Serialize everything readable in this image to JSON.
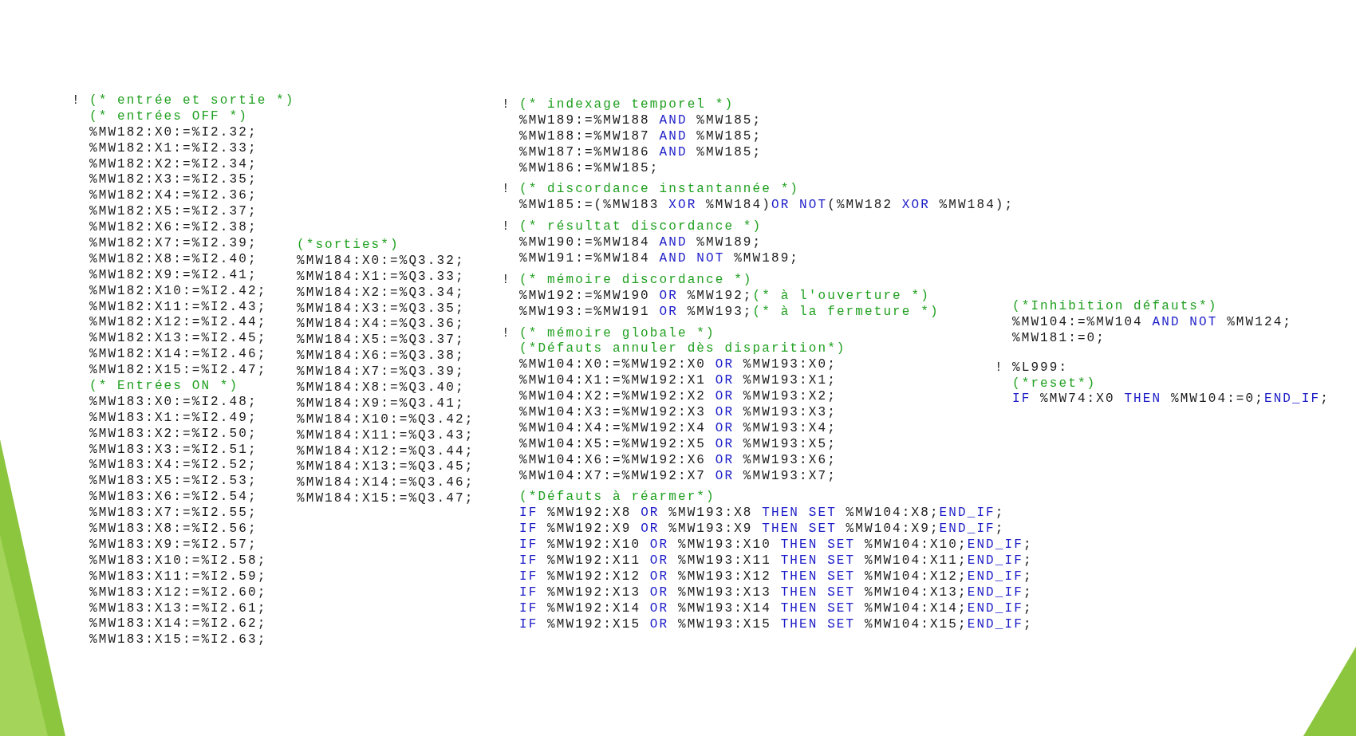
{
  "code_blocks": [
    {
      "sections": [
        {
          "lines": [
            {
              "marker": "!",
              "tokens": [
                {
                  "kind": "comment",
                  "text": "(* entrée et sortie *)"
                }
              ]
            },
            {
              "tokens": [
                {
                  "kind": "comment",
                  "text": "(* entrées OFF *)"
                }
              ]
            },
            {
              "tokens": [
                {
                  "kind": "code",
                  "text": "%MW182:X0:=%I2.32;"
                }
              ]
            },
            {
              "tokens": [
                {
                  "kind": "code",
                  "text": "%MW182:X1:=%I2.33;"
                }
              ]
            },
            {
              "tokens": [
                {
                  "kind": "code",
                  "text": "%MW182:X2:=%I2.34;"
                }
              ]
            },
            {
              "tokens": [
                {
                  "kind": "code",
                  "text": "%MW182:X3:=%I2.35;"
                }
              ]
            },
            {
              "tokens": [
                {
                  "kind": "code",
                  "text": "%MW182:X4:=%I2.36;"
                }
              ]
            },
            {
              "tokens": [
                {
                  "kind": "code",
                  "text": "%MW182:X5:=%I2.37;"
                }
              ]
            },
            {
              "tokens": [
                {
                  "kind": "code",
                  "text": "%MW182:X6:=%I2.38;"
                }
              ]
            },
            {
              "tokens": [
                {
                  "kind": "code",
                  "text": "%MW182:X7:=%I2.39;"
                }
              ]
            },
            {
              "tokens": [
                {
                  "kind": "code",
                  "text": "%MW182:X8:=%I2.40;"
                }
              ]
            },
            {
              "tokens": [
                {
                  "kind": "code",
                  "text": "%MW182:X9:=%I2.41;"
                }
              ]
            },
            {
              "tokens": [
                {
                  "kind": "code",
                  "text": "%MW182:X10:=%I2.42;"
                }
              ]
            },
            {
              "tokens": [
                {
                  "kind": "code",
                  "text": "%MW182:X11:=%I2.43;"
                }
              ]
            },
            {
              "tokens": [
                {
                  "kind": "code",
                  "text": "%MW182:X12:=%I2.44;"
                }
              ]
            },
            {
              "tokens": [
                {
                  "kind": "code",
                  "text": "%MW182:X13:=%I2.45;"
                }
              ]
            },
            {
              "tokens": [
                {
                  "kind": "code",
                  "text": "%MW182:X14:=%I2.46;"
                }
              ]
            },
            {
              "tokens": [
                {
                  "kind": "code",
                  "text": "%MW182:X15:=%I2.47;"
                }
              ]
            },
            {
              "tokens": [
                {
                  "kind": "comment",
                  "text": "(* Entrées ON *)"
                }
              ]
            },
            {
              "tokens": [
                {
                  "kind": "code",
                  "text": "%MW183:X0:=%I2.48;"
                }
              ]
            },
            {
              "tokens": [
                {
                  "kind": "code",
                  "text": "%MW183:X1:=%I2.49;"
                }
              ]
            },
            {
              "tokens": [
                {
                  "kind": "code",
                  "text": "%MW183:X2:=%I2.50;"
                }
              ]
            },
            {
              "tokens": [
                {
                  "kind": "code",
                  "text": "%MW183:X3:=%I2.51;"
                }
              ]
            },
            {
              "tokens": [
                {
                  "kind": "code",
                  "text": "%MW183:X4:=%I2.52;"
                }
              ]
            },
            {
              "tokens": [
                {
                  "kind": "code",
                  "text": "%MW183:X5:=%I2.53;"
                }
              ]
            },
            {
              "tokens": [
                {
                  "kind": "code",
                  "text": "%MW183:X6:=%I2.54;"
                }
              ]
            },
            {
              "tokens": [
                {
                  "kind": "code",
                  "text": "%MW183:X7:=%I2.55;"
                }
              ]
            },
            {
              "tokens": [
                {
                  "kind": "code",
                  "text": "%MW183:X8:=%I2.56;"
                }
              ]
            },
            {
              "tokens": [
                {
                  "kind": "code",
                  "text": "%MW183:X9:=%I2.57;"
                }
              ]
            },
            {
              "tokens": [
                {
                  "kind": "code",
                  "text": "%MW183:X10:=%I2.58;"
                }
              ]
            },
            {
              "tokens": [
                {
                  "kind": "code",
                  "text": "%MW183:X11:=%I2.59;"
                }
              ]
            },
            {
              "tokens": [
                {
                  "kind": "code",
                  "text": "%MW183:X12:=%I2.60;"
                }
              ]
            },
            {
              "tokens": [
                {
                  "kind": "code",
                  "text": "%MW183:X13:=%I2.61;"
                }
              ]
            },
            {
              "tokens": [
                {
                  "kind": "code",
                  "text": "%MW183:X14:=%I2.62;"
                }
              ]
            },
            {
              "tokens": [
                {
                  "kind": "code",
                  "text": "%MW183:X15:=%I2.63;"
                }
              ]
            }
          ]
        }
      ]
    },
    {
      "sections": [
        {
          "lines": [
            {
              "tokens": [
                {
                  "kind": "comment",
                  "text": "(*sorties*)"
                }
              ]
            },
            {
              "tokens": [
                {
                  "kind": "code",
                  "text": "%MW184:X0:=%Q3.32;"
                }
              ]
            },
            {
              "tokens": [
                {
                  "kind": "code",
                  "text": "%MW184:X1:=%Q3.33;"
                }
              ]
            },
            {
              "tokens": [
                {
                  "kind": "code",
                  "text": "%MW184:X2:=%Q3.34;"
                }
              ]
            },
            {
              "tokens": [
                {
                  "kind": "code",
                  "text": "%MW184:X3:=%Q3.35;"
                }
              ]
            },
            {
              "tokens": [
                {
                  "kind": "code",
                  "text": "%MW184:X4:=%Q3.36;"
                }
              ]
            },
            {
              "tokens": [
                {
                  "kind": "code",
                  "text": "%MW184:X5:=%Q3.37;"
                }
              ]
            },
            {
              "tokens": [
                {
                  "kind": "code",
                  "text": "%MW184:X6:=%Q3.38;"
                }
              ]
            },
            {
              "tokens": [
                {
                  "kind": "code",
                  "text": "%MW184:X7:=%Q3.39;"
                }
              ]
            },
            {
              "tokens": [
                {
                  "kind": "code",
                  "text": "%MW184:X8:=%Q3.40;"
                }
              ]
            },
            {
              "tokens": [
                {
                  "kind": "code",
                  "text": "%MW184:X9:=%Q3.41;"
                }
              ]
            },
            {
              "tokens": [
                {
                  "kind": "code",
                  "text": "%MW184:X10:=%Q3.42;"
                }
              ]
            },
            {
              "tokens": [
                {
                  "kind": "code",
                  "text": "%MW184:X11:=%Q3.43;"
                }
              ]
            },
            {
              "tokens": [
                {
                  "kind": "code",
                  "text": "%MW184:X12:=%Q3.44;"
                }
              ]
            },
            {
              "tokens": [
                {
                  "kind": "code",
                  "text": "%MW184:X13:=%Q3.45;"
                }
              ]
            },
            {
              "tokens": [
                {
                  "kind": "code",
                  "text": "%MW184:X14:=%Q3.46;"
                }
              ]
            },
            {
              "tokens": [
                {
                  "kind": "code",
                  "text": "%MW184:X15:=%Q3.47;"
                }
              ]
            }
          ]
        }
      ]
    },
    {
      "sections": [
        {
          "lines": [
            {
              "marker": "!",
              "tokens": [
                {
                  "kind": "comment",
                  "text": "(* indexage temporel *)"
                }
              ]
            },
            {
              "tokens": [
                {
                  "kind": "code",
                  "text": "%MW189:=%MW188 "
                },
                {
                  "kind": "keyword",
                  "text": "AND"
                },
                {
                  "kind": "code",
                  "text": " %MW185;"
                }
              ]
            },
            {
              "tokens": [
                {
                  "kind": "code",
                  "text": "%MW188:=%MW187 "
                },
                {
                  "kind": "keyword",
                  "text": "AND"
                },
                {
                  "kind": "code",
                  "text": " %MW185;"
                }
              ]
            },
            {
              "tokens": [
                {
                  "kind": "code",
                  "text": "%MW187:=%MW186 "
                },
                {
                  "kind": "keyword",
                  "text": "AND"
                },
                {
                  "kind": "code",
                  "text": " %MW185;"
                }
              ]
            },
            {
              "tokens": [
                {
                  "kind": "code",
                  "text": "%MW186:=%MW185;"
                }
              ]
            }
          ]
        },
        {
          "lines": [
            {
              "marker": "!",
              "tokens": [
                {
                  "kind": "comment",
                  "text": "(* discordance instantannée *)"
                }
              ]
            },
            {
              "tokens": [
                {
                  "kind": "code",
                  "text": "%MW185:=(%MW183 "
                },
                {
                  "kind": "keyword",
                  "text": "XOR"
                },
                {
                  "kind": "code",
                  "text": " %MW184)"
                },
                {
                  "kind": "keyword",
                  "text": "OR NOT"
                },
                {
                  "kind": "code",
                  "text": "(%MW182 "
                },
                {
                  "kind": "keyword",
                  "text": "XOR"
                },
                {
                  "kind": "code",
                  "text": " %MW184);"
                }
              ]
            }
          ]
        },
        {
          "lines": [
            {
              "marker": "!",
              "tokens": [
                {
                  "kind": "comment",
                  "text": "(* résultat discordance *)"
                }
              ]
            },
            {
              "tokens": [
                {
                  "kind": "code",
                  "text": "%MW190:=%MW184 "
                },
                {
                  "kind": "keyword",
                  "text": "AND"
                },
                {
                  "kind": "code",
                  "text": " %MW189;"
                }
              ]
            },
            {
              "tokens": [
                {
                  "kind": "code",
                  "text": "%MW191:=%MW184 "
                },
                {
                  "kind": "keyword",
                  "text": "AND NOT"
                },
                {
                  "kind": "code",
                  "text": " %MW189;"
                }
              ]
            }
          ]
        },
        {
          "lines": [
            {
              "marker": "!",
              "tokens": [
                {
                  "kind": "comment",
                  "text": "(* mémoire discordance *)"
                }
              ]
            },
            {
              "tokens": [
                {
                  "kind": "code",
                  "text": "%MW192:=%MW190 "
                },
                {
                  "kind": "keyword",
                  "text": "OR"
                },
                {
                  "kind": "code",
                  "text": " %MW192;"
                },
                {
                  "kind": "comment",
                  "text": "(* à l'ouverture *)"
                }
              ]
            },
            {
              "tokens": [
                {
                  "kind": "code",
                  "text": "%MW193:=%MW191 "
                },
                {
                  "kind": "keyword",
                  "text": "OR"
                },
                {
                  "kind": "code",
                  "text": " %MW193;"
                },
                {
                  "kind": "comment",
                  "text": "(* à la fermeture *)"
                }
              ]
            }
          ]
        },
        {
          "lines": [
            {
              "marker": "!",
              "tokens": [
                {
                  "kind": "comment",
                  "text": "(* mémoire globale *)"
                }
              ]
            },
            {
              "tokens": [
                {
                  "kind": "comment",
                  "text": "(*Défauts annuler dès disparition*)"
                }
              ]
            },
            {
              "tokens": [
                {
                  "kind": "code",
                  "text": "%MW104:X0:=%MW192:X0 "
                },
                {
                  "kind": "keyword",
                  "text": "OR"
                },
                {
                  "kind": "code",
                  "text": " %MW193:X0;"
                }
              ]
            },
            {
              "tokens": [
                {
                  "kind": "code",
                  "text": "%MW104:X1:=%MW192:X1 "
                },
                {
                  "kind": "keyword",
                  "text": "OR"
                },
                {
                  "kind": "code",
                  "text": " %MW193:X1;"
                }
              ]
            },
            {
              "tokens": [
                {
                  "kind": "code",
                  "text": "%MW104:X2:=%MW192:X2 "
                },
                {
                  "kind": "keyword",
                  "text": "OR"
                },
                {
                  "kind": "code",
                  "text": " %MW193:X2;"
                }
              ]
            },
            {
              "tokens": [
                {
                  "kind": "code",
                  "text": "%MW104:X3:=%MW192:X3 "
                },
                {
                  "kind": "keyword",
                  "text": "OR"
                },
                {
                  "kind": "code",
                  "text": " %MW193:X3;"
                }
              ]
            },
            {
              "tokens": [
                {
                  "kind": "code",
                  "text": "%MW104:X4:=%MW192:X4 "
                },
                {
                  "kind": "keyword",
                  "text": "OR"
                },
                {
                  "kind": "code",
                  "text": " %MW193:X4;"
                }
              ]
            },
            {
              "tokens": [
                {
                  "kind": "code",
                  "text": "%MW104:X5:=%MW192:X5 "
                },
                {
                  "kind": "keyword",
                  "text": "OR"
                },
                {
                  "kind": "code",
                  "text": " %MW193:X5;"
                }
              ]
            },
            {
              "tokens": [
                {
                  "kind": "code",
                  "text": "%MW104:X6:=%MW192:X6 "
                },
                {
                  "kind": "keyword",
                  "text": "OR"
                },
                {
                  "kind": "code",
                  "text": " %MW193:X6;"
                }
              ]
            },
            {
              "tokens": [
                {
                  "kind": "code",
                  "text": "%MW104:X7:=%MW192:X7 "
                },
                {
                  "kind": "keyword",
                  "text": "OR"
                },
                {
                  "kind": "code",
                  "text": " %MW193:X7;"
                }
              ]
            }
          ]
        },
        {
          "lines": [
            {
              "tokens": [
                {
                  "kind": "comment",
                  "text": "(*Défauts à réarmer*)"
                }
              ]
            },
            {
              "tokens": [
                {
                  "kind": "keyword",
                  "text": "IF"
                },
                {
                  "kind": "code",
                  "text": " %MW192:X8 "
                },
                {
                  "kind": "keyword",
                  "text": "OR"
                },
                {
                  "kind": "code",
                  "text": " %MW193:X8 "
                },
                {
                  "kind": "keyword",
                  "text": "THEN SET"
                },
                {
                  "kind": "code",
                  "text": " %MW104:X8;"
                },
                {
                  "kind": "keyword",
                  "text": "END_IF"
                },
                {
                  "kind": "code",
                  "text": ";"
                }
              ]
            },
            {
              "tokens": [
                {
                  "kind": "keyword",
                  "text": "IF"
                },
                {
                  "kind": "code",
                  "text": " %MW192:X9 "
                },
                {
                  "kind": "keyword",
                  "text": "OR"
                },
                {
                  "kind": "code",
                  "text": " %MW193:X9 "
                },
                {
                  "kind": "keyword",
                  "text": "THEN SET"
                },
                {
                  "kind": "code",
                  "text": " %MW104:X9;"
                },
                {
                  "kind": "keyword",
                  "text": "END_IF"
                },
                {
                  "kind": "code",
                  "text": ";"
                }
              ]
            },
            {
              "tokens": [
                {
                  "kind": "keyword",
                  "text": "IF"
                },
                {
                  "kind": "code",
                  "text": " %MW192:X10 "
                },
                {
                  "kind": "keyword",
                  "text": "OR"
                },
                {
                  "kind": "code",
                  "text": " %MW193:X10 "
                },
                {
                  "kind": "keyword",
                  "text": "THEN SET"
                },
                {
                  "kind": "code",
                  "text": " %MW104:X10;"
                },
                {
                  "kind": "keyword",
                  "text": "END_IF"
                },
                {
                  "kind": "code",
                  "text": ";"
                }
              ]
            },
            {
              "tokens": [
                {
                  "kind": "keyword",
                  "text": "IF"
                },
                {
                  "kind": "code",
                  "text": " %MW192:X11 "
                },
                {
                  "kind": "keyword",
                  "text": "OR"
                },
                {
                  "kind": "code",
                  "text": " %MW193:X11 "
                },
                {
                  "kind": "keyword",
                  "text": "THEN SET"
                },
                {
                  "kind": "code",
                  "text": " %MW104:X11;"
                },
                {
                  "kind": "keyword",
                  "text": "END_IF"
                },
                {
                  "kind": "code",
                  "text": ";"
                }
              ]
            },
            {
              "tokens": [
                {
                  "kind": "keyword",
                  "text": "IF"
                },
                {
                  "kind": "code",
                  "text": " %MW192:X12 "
                },
                {
                  "kind": "keyword",
                  "text": "OR"
                },
                {
                  "kind": "code",
                  "text": " %MW193:X12 "
                },
                {
                  "kind": "keyword",
                  "text": "THEN SET"
                },
                {
                  "kind": "code",
                  "text": " %MW104:X12;"
                },
                {
                  "kind": "keyword",
                  "text": "END_IF"
                },
                {
                  "kind": "code",
                  "text": ";"
                }
              ]
            },
            {
              "tokens": [
                {
                  "kind": "keyword",
                  "text": "IF"
                },
                {
                  "kind": "code",
                  "text": " %MW192:X13 "
                },
                {
                  "kind": "keyword",
                  "text": "OR"
                },
                {
                  "kind": "code",
                  "text": " %MW193:X13 "
                },
                {
                  "kind": "keyword",
                  "text": "THEN SET"
                },
                {
                  "kind": "code",
                  "text": " %MW104:X13;"
                },
                {
                  "kind": "keyword",
                  "text": "END_IF"
                },
                {
                  "kind": "code",
                  "text": ";"
                }
              ]
            },
            {
              "tokens": [
                {
                  "kind": "keyword",
                  "text": "IF"
                },
                {
                  "kind": "code",
                  "text": " %MW192:X14 "
                },
                {
                  "kind": "keyword",
                  "text": "OR"
                },
                {
                  "kind": "code",
                  "text": " %MW193:X14 "
                },
                {
                  "kind": "keyword",
                  "text": "THEN SET"
                },
                {
                  "kind": "code",
                  "text": " %MW104:X14;"
                },
                {
                  "kind": "keyword",
                  "text": "END_IF"
                },
                {
                  "kind": "code",
                  "text": ";"
                }
              ]
            },
            {
              "tokens": [
                {
                  "kind": "keyword",
                  "text": "IF"
                },
                {
                  "kind": "code",
                  "text": " %MW192:X15 "
                },
                {
                  "kind": "keyword",
                  "text": "OR"
                },
                {
                  "kind": "code",
                  "text": " %MW193:X15 "
                },
                {
                  "kind": "keyword",
                  "text": "THEN SET"
                },
                {
                  "kind": "code",
                  "text": " %MW104:X15;"
                },
                {
                  "kind": "keyword",
                  "text": "END_IF"
                },
                {
                  "kind": "code",
                  "text": ";"
                }
              ]
            }
          ]
        }
      ]
    },
    {
      "sections": [
        {
          "lines": [
            {
              "tokens": [
                {
                  "kind": "comment",
                  "text": "(*Inhibition défauts*)"
                }
              ]
            },
            {
              "tokens": [
                {
                  "kind": "code",
                  "text": "%MW104:=%MW104 "
                },
                {
                  "kind": "keyword",
                  "text": "AND NOT"
                },
                {
                  "kind": "code",
                  "text": " %MW124;"
                }
              ]
            },
            {
              "tokens": [
                {
                  "kind": "code",
                  "text": "%MW181:=0;"
                }
              ]
            }
          ]
        },
        {
          "lines": [
            {
              "marker": "!",
              "tokens": [
                {
                  "kind": "code",
                  "text": "%L999:"
                }
              ]
            },
            {
              "tokens": [
                {
                  "kind": "comment",
                  "text": "(*reset*)"
                }
              ]
            },
            {
              "tokens": [
                {
                  "kind": "keyword",
                  "text": "IF"
                },
                {
                  "kind": "code",
                  "text": " %MW74:X0 "
                },
                {
                  "kind": "keyword",
                  "text": "THEN"
                },
                {
                  "kind": "code",
                  "text": " %MW104:=0;"
                },
                {
                  "kind": "keyword",
                  "text": "END_IF"
                },
                {
                  "kind": "code",
                  "text": ";"
                }
              ]
            }
          ]
        }
      ]
    }
  ]
}
